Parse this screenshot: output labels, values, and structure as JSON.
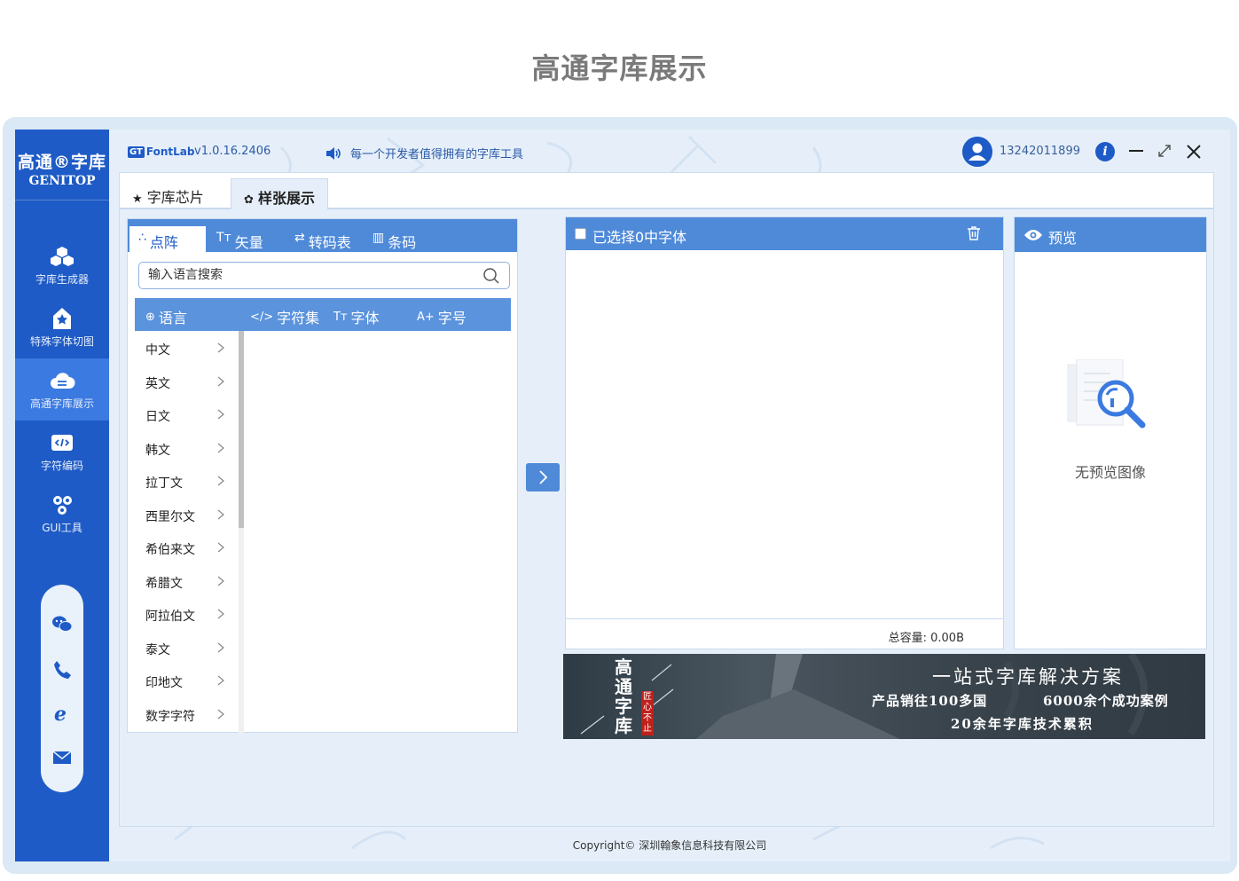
{
  "page_title": "高通字库展示",
  "sidebar": {
    "logo_line1": "高通®字库",
    "logo_line2": "GENITOP",
    "items": [
      {
        "label": "字库生成器",
        "icon": "cubes-icon"
      },
      {
        "label": "特殊字体切图",
        "icon": "star-home-icon"
      },
      {
        "label": "高通字库展示",
        "icon": "cloud-icon"
      },
      {
        "label": "字符编码",
        "icon": "code-icon"
      },
      {
        "label": "GUI工具",
        "icon": "gears-icon"
      }
    ],
    "contacts": [
      "wechat-icon",
      "phone-icon",
      "ie-icon",
      "mail-icon"
    ]
  },
  "topbar": {
    "brand": "FontLab",
    "brand_badge": "GT",
    "version": "v1.0.16.2406",
    "slogan": "每一个开发者值得拥有的字库工具",
    "phone": "13242011899",
    "info": "i"
  },
  "tabs": [
    {
      "label": "字库芯片",
      "icon": "★"
    },
    {
      "label": "样张展示",
      "icon": "✿"
    }
  ],
  "left_panel": {
    "tabs": [
      {
        "label": "点阵",
        "icon": "∴"
      },
      {
        "label": "矢量",
        "icon": "Tт"
      },
      {
        "label": "转码表",
        "icon": "⇄"
      },
      {
        "label": "条码",
        "icon": "▥"
      }
    ],
    "search_placeholder": "输入语言搜索",
    "columns": [
      {
        "label": "语言",
        "icon": "⊕"
      },
      {
        "label": "字符集",
        "icon": "</>"
      },
      {
        "label": "字体",
        "icon": "Tт"
      },
      {
        "label": "字号",
        "icon": "A+"
      }
    ],
    "languages": [
      "中文",
      "英文",
      "日文",
      "韩文",
      "拉丁文",
      "西里尔文",
      "希伯来文",
      "希腊文",
      "阿拉伯文",
      "泰文",
      "印地文",
      "数字字符"
    ]
  },
  "mid_panel": {
    "title": "已选择0中字体",
    "capacity": "总容量: 0.00B"
  },
  "right_panel": {
    "title": "预览",
    "empty_text": "无预览图像"
  },
  "banner": {
    "vertical_title": "高通字库",
    "seal": "匠心不止",
    "headline": "一站式字库解决方案",
    "line1": "产品销往100多国",
    "line2": "6000余个成功案例",
    "line3": "20余年字库技术累积"
  },
  "footer": "Copyright© 深圳翰象信息科技有限公司",
  "colors": {
    "primary": "#1e5bc6",
    "header": "#4f8ad9",
    "background": "#e6eff9"
  }
}
